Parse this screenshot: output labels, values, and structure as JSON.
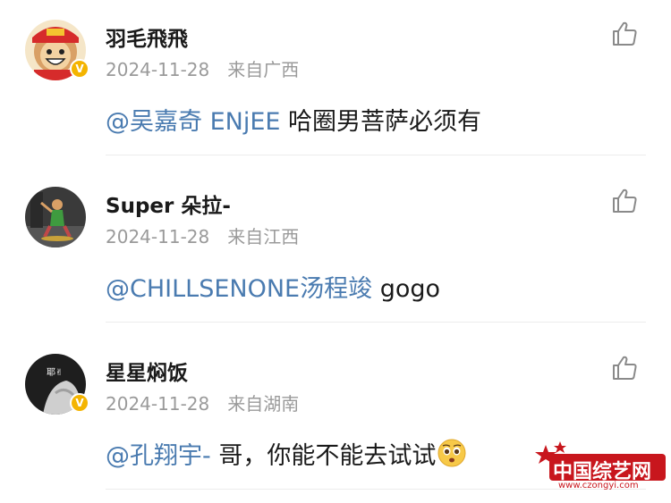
{
  "comments": [
    {
      "username": "羽毛飛飛",
      "date": "2024-11-28",
      "location": "来自广西",
      "verified": true,
      "mention": "@吴嘉奇 ENjEE",
      "text": " 哈圈男菩萨必须有"
    },
    {
      "username": "Super 朵拉-",
      "date": "2024-11-28",
      "location": "来自江西",
      "verified": false,
      "mention": "@CHILLSENONE汤程竣",
      "text": " gogo"
    },
    {
      "username": "星星焖饭",
      "date": "2024-11-28",
      "location": "来自湖南",
      "verified": true,
      "mention": "@孔翔宇-",
      "text": " 哥，你能不能去试试"
    }
  ],
  "icons": {
    "like": "thumbs-up-icon",
    "verified": "verified-badge-icon",
    "emoji": "pleading-face-emoji"
  },
  "colors": {
    "mention": "#4a7bb0",
    "meta": "#9a9a9a",
    "badge": "#f4b400",
    "watermark": "#c8161d"
  },
  "badge_glyph": "V",
  "watermark": {
    "title": "中国综艺网",
    "url": "www.czongyi.com"
  }
}
